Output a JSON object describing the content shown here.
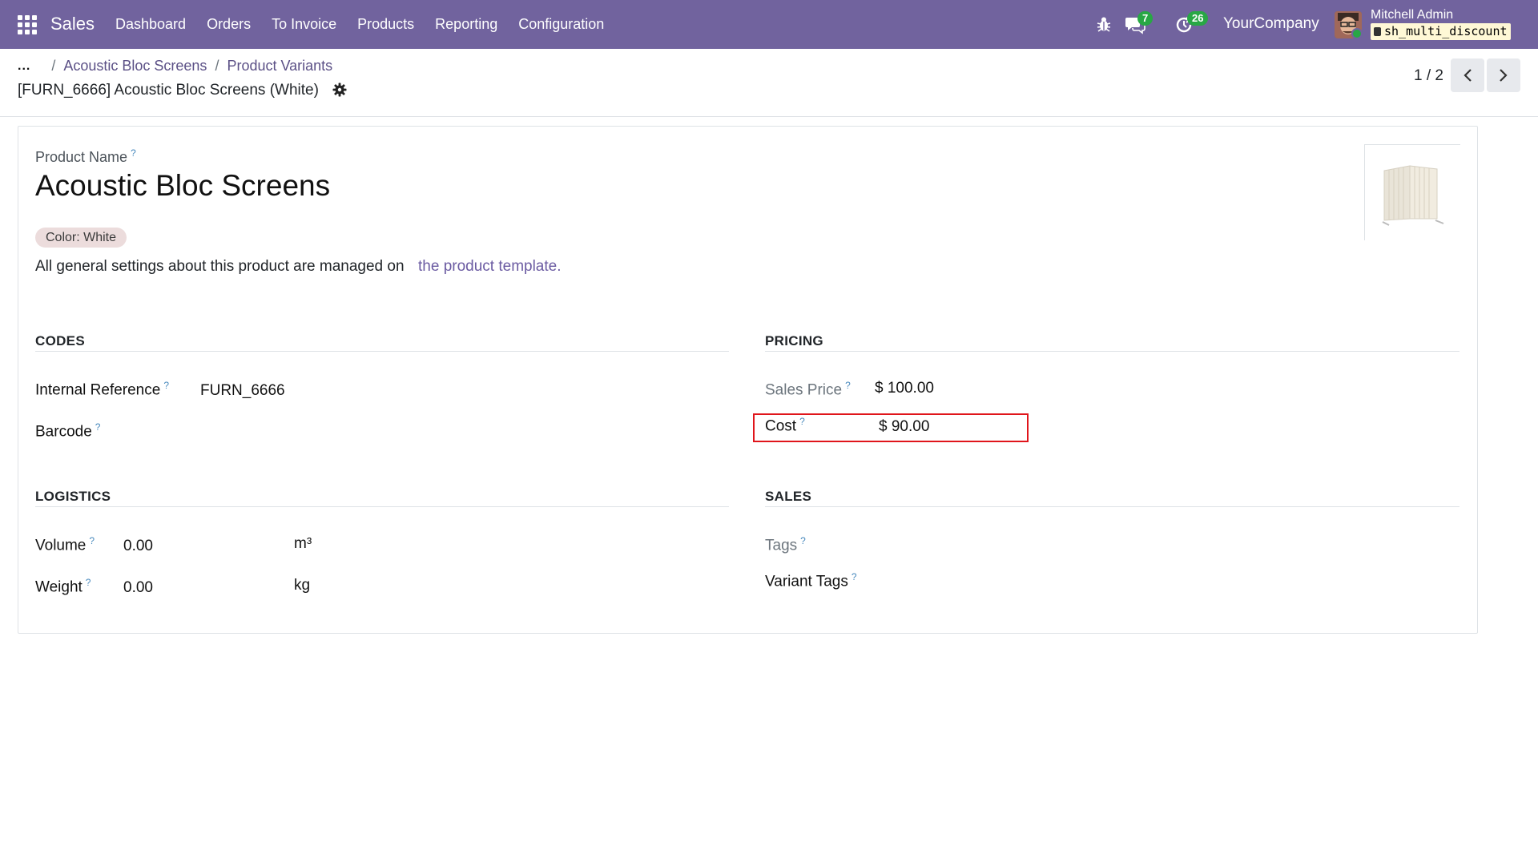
{
  "navbar": {
    "app_name": "Sales",
    "menu": [
      "Dashboard",
      "Orders",
      "To Invoice",
      "Products",
      "Reporting",
      "Configuration"
    ],
    "messages_count": "7",
    "activities_count": "26",
    "company": "YourCompany",
    "user_name": "Mitchell Admin",
    "db_name": "sh_multi_discount",
    "accent_color": "#71639e"
  },
  "breadcrumb": {
    "dots": "...",
    "separator": "/",
    "items": [
      "Acoustic Bloc Screens",
      "Product Variants"
    ]
  },
  "record": {
    "title": "[FURN_6666] Acoustic Bloc Screens (White)"
  },
  "pager": {
    "value": "1 / 2"
  },
  "form": {
    "product_name_label": "Product Name",
    "product_name": "Acoustic Bloc Screens",
    "variant_chip": "Color: White",
    "info_text": "All general settings about this product are managed on",
    "template_link": "the product template.",
    "help_mark": "?",
    "codes": {
      "title": "CODES",
      "internal_reference_label": "Internal Reference",
      "internal_reference": "FURN_6666",
      "barcode_label": "Barcode",
      "barcode": ""
    },
    "pricing": {
      "title": "PRICING",
      "sales_price_label": "Sales Price",
      "sales_price": "$ 100.00",
      "cost_label": "Cost",
      "cost": "$ 90.00"
    },
    "logistics": {
      "title": "LOGISTICS",
      "volume_label": "Volume",
      "volume": "0.00",
      "volume_unit": "m³",
      "weight_label": "Weight",
      "weight": "0.00",
      "weight_unit": "kg"
    },
    "sales": {
      "title": "SALES",
      "tags_label": "Tags",
      "variant_tags_label": "Variant Tags"
    }
  }
}
